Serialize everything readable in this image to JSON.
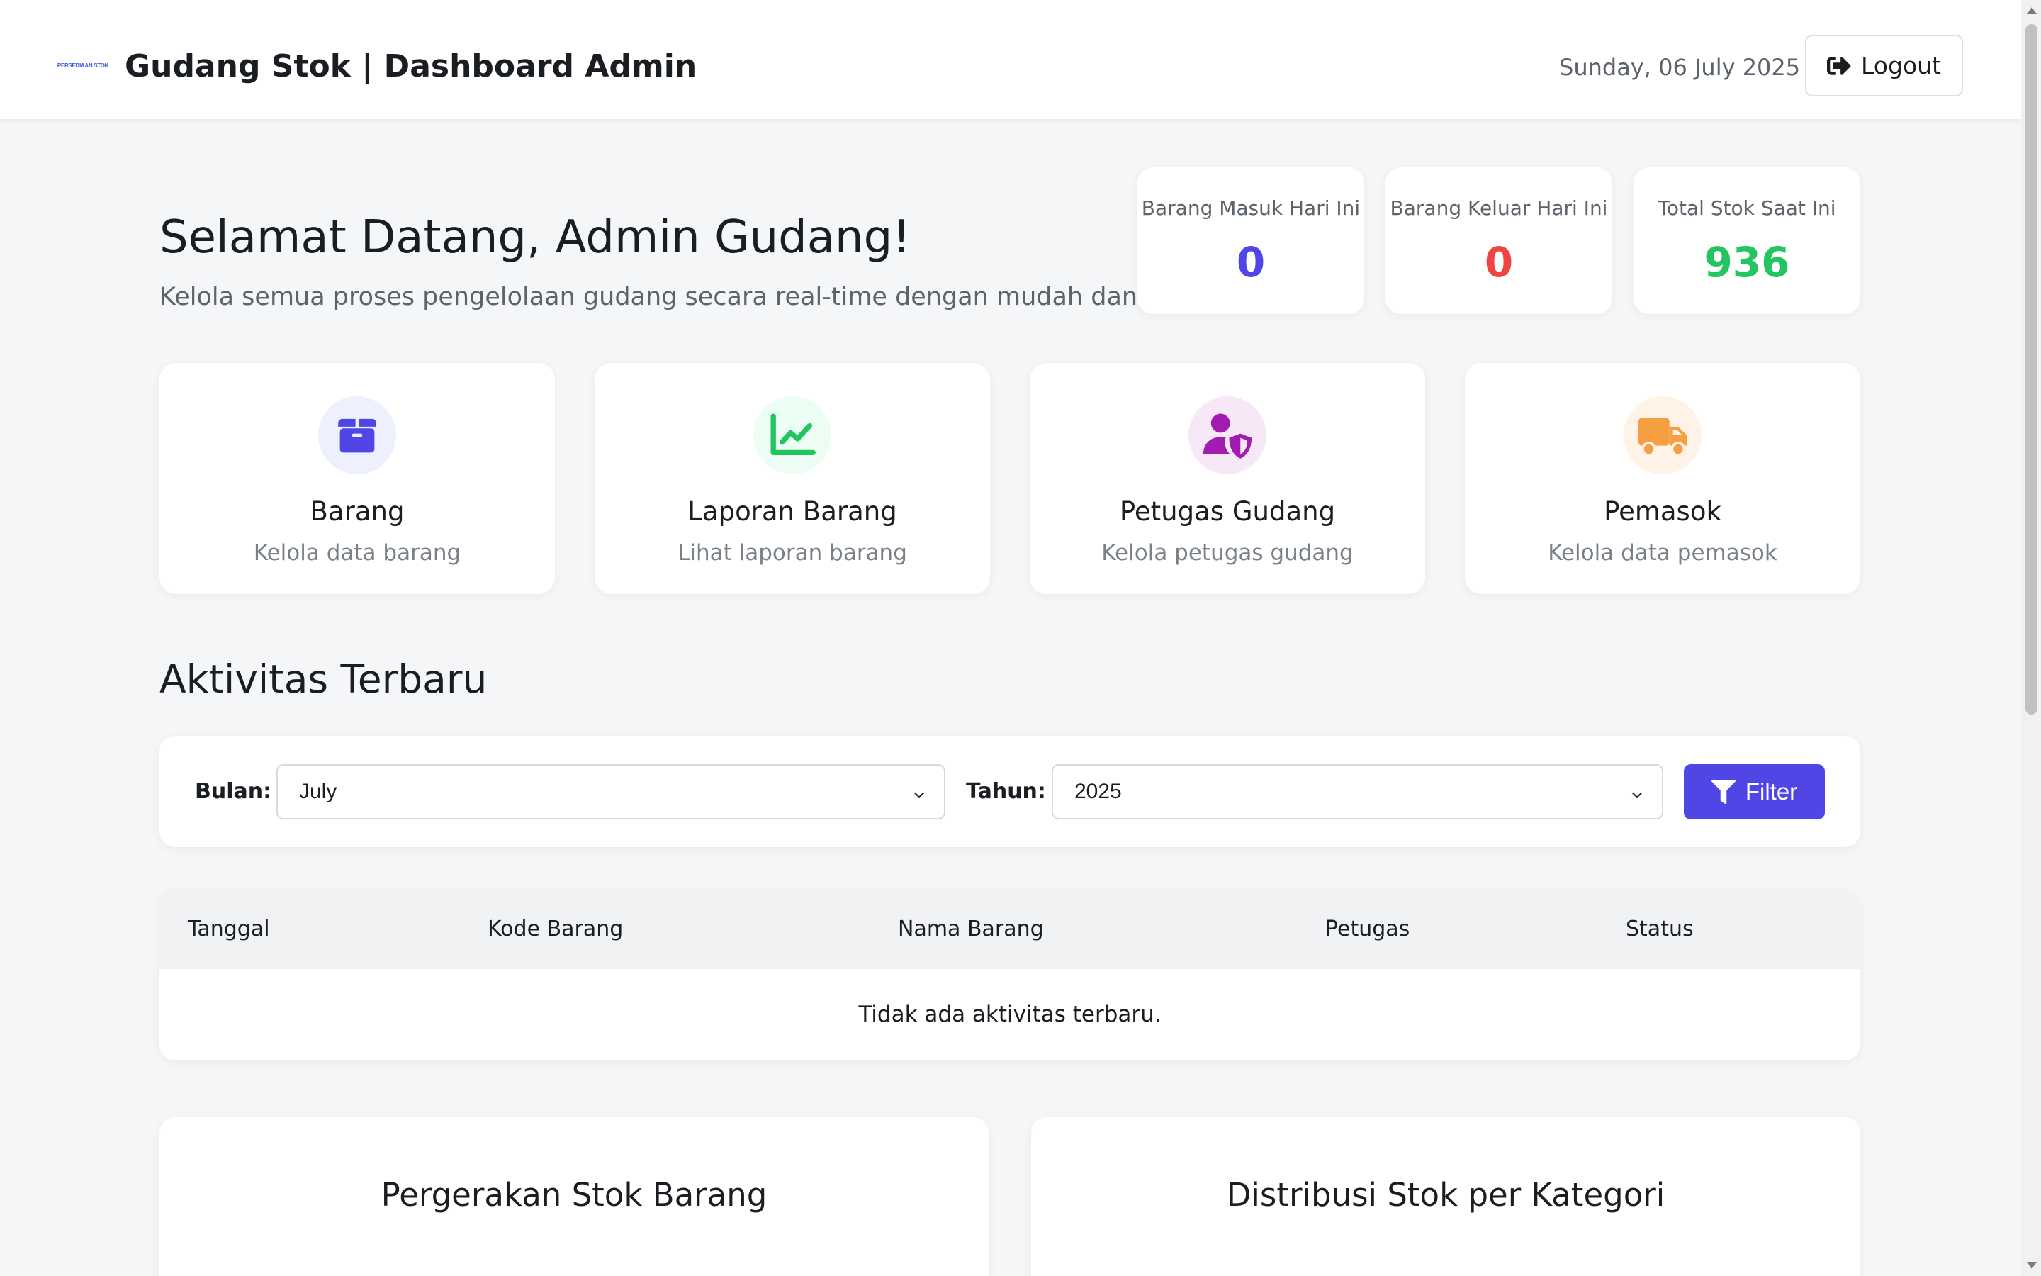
{
  "header": {
    "logo_text": "PERSEDIAAN STOK",
    "title": "Gudang Stok | Dashboard Admin",
    "date": "Sunday, 06 July 2025",
    "logout_label": "Logout"
  },
  "welcome": {
    "title": "Selamat Datang, Admin Gudang!",
    "subtitle": "Kelola semua proses pengelolaan gudang secara real-time dengan mudah dan cepat."
  },
  "stats": [
    {
      "label": "Barang Masuk Hari Ini",
      "value": "0",
      "color": "#4f46e5"
    },
    {
      "label": "Barang Keluar Hari Ini",
      "value": "0",
      "color": "#ef4444"
    },
    {
      "label": "Total Stok Saat Ini",
      "value": "936",
      "color": "#22c55e"
    }
  ],
  "menu": [
    {
      "title": "Barang",
      "desc": "Kelola data barang",
      "icon": "box-icon",
      "color": "#4f46e5"
    },
    {
      "title": "Laporan Barang",
      "desc": "Lihat laporan barang",
      "icon": "chart-line-icon",
      "color": "#22c55e"
    },
    {
      "title": "Petugas Gudang",
      "desc": "Kelola petugas gudang",
      "icon": "user-shield-icon",
      "color": "#a21caf"
    },
    {
      "title": "Pemasok",
      "desc": "Kelola data pemasok",
      "icon": "truck-icon",
      "color": "#f59e42"
    }
  ],
  "activity": {
    "title": "Aktivitas Terbaru",
    "filter": {
      "month_label": "Bulan:",
      "month_value": "July",
      "year_label": "Tahun:",
      "year_value": "2025",
      "button_label": "Filter"
    },
    "columns": [
      "Tanggal",
      "Kode Barang",
      "Nama Barang",
      "Petugas",
      "Status"
    ],
    "empty_message": "Tidak ada aktivitas terbaru."
  },
  "charts": {
    "movement_title": "Pergerakan Stok Barang",
    "distribution_title": "Distribusi Stok per Kategori"
  }
}
